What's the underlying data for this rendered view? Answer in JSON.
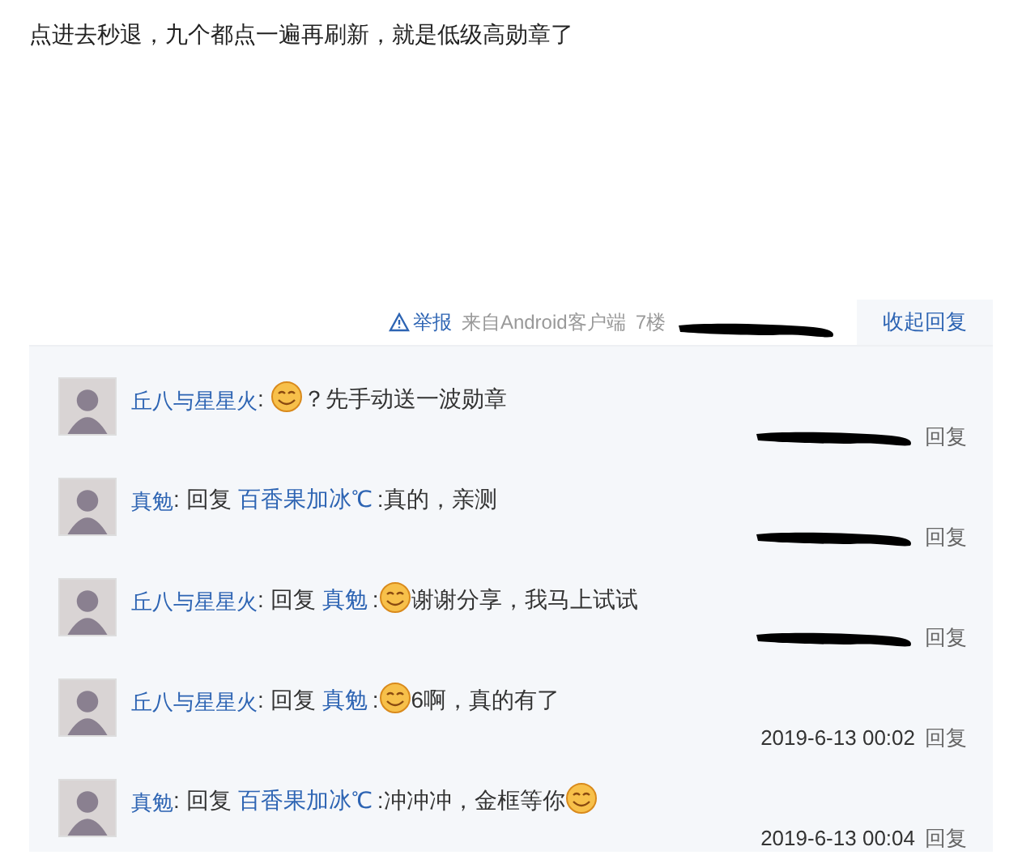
{
  "post": {
    "text": "点进去秒退，九个都点一遍再刷新，就是低级高勋章了"
  },
  "post_footer": {
    "report": "举报",
    "source": "来自Android客户端",
    "floor": "7楼",
    "time_redacted": true,
    "toggle": "收起回复"
  },
  "replies": [
    {
      "user": "丘八与星星火",
      "separator": ":",
      "content": [
        {
          "kind": "emoticon"
        },
        {
          "kind": "text",
          "text": "？先手动送一波勋章"
        }
      ],
      "time_redacted": true,
      "reply": "回复"
    },
    {
      "user": "真勉",
      "separator": ":",
      "prefix": "回复",
      "target": "百香果加冰℃",
      "content": [
        {
          "kind": "text",
          "text": ":真的，亲测"
        }
      ],
      "time_redacted": true,
      "reply": "回复"
    },
    {
      "user": "丘八与星星火",
      "separator": ":",
      "prefix": "回复",
      "target": "真勉",
      "content": [
        {
          "kind": "text",
          "text": ":"
        },
        {
          "kind": "emoticon"
        },
        {
          "kind": "text",
          "text": "谢谢分享，我马上试试"
        }
      ],
      "time_redacted": true,
      "reply": "回复"
    },
    {
      "user": "丘八与星星火",
      "separator": ":",
      "prefix": "回复",
      "target": "真勉",
      "content": [
        {
          "kind": "text",
          "text": ":"
        },
        {
          "kind": "emoticon"
        },
        {
          "kind": "text",
          "text": "6啊，真的有了"
        }
      ],
      "time": "2019-6-13 00:02",
      "reply": "回复"
    },
    {
      "user": "真勉",
      "separator": ":",
      "prefix": "回复",
      "target": "百香果加冰℃",
      "content": [
        {
          "kind": "text",
          "text": ":冲冲冲，金框等你"
        },
        {
          "kind": "emoticon"
        }
      ],
      "time": "2019-6-13 00:04",
      "reply": "回复"
    }
  ]
}
